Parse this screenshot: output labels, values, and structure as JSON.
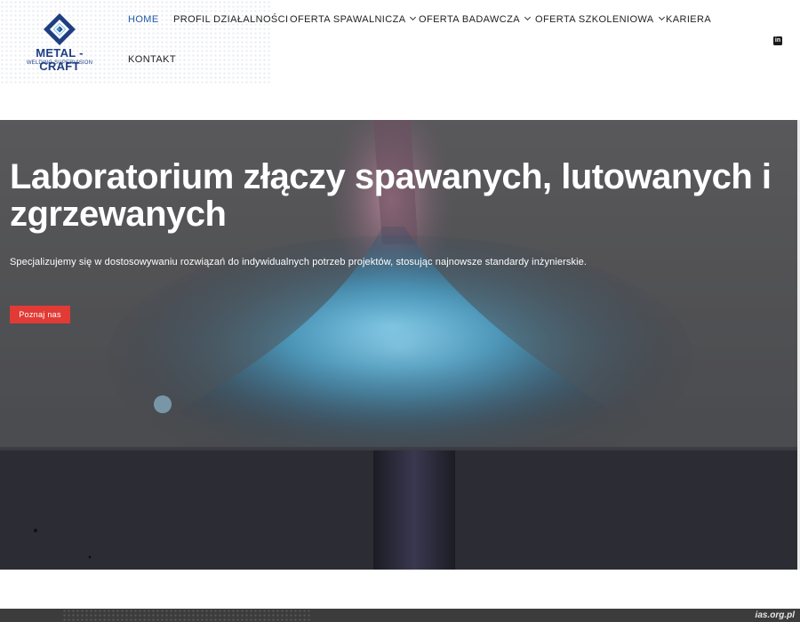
{
  "logo": {
    "name": "METAL - CRAFT",
    "tagline": "WELDING SUPERVISION",
    "color": "#1f3e82"
  },
  "nav": {
    "items": [
      {
        "label": "HOME",
        "active": true,
        "dropdown": false
      },
      {
        "label": "PROFIL DZIAŁALNOŚCI",
        "active": false,
        "dropdown": false
      },
      {
        "label": "OFERTA SPAWALNICZA",
        "active": false,
        "dropdown": true
      },
      {
        "label": "OFERTA BADAWCZA",
        "active": false,
        "dropdown": true
      },
      {
        "label": "OFERTA SZKOLENIOWA",
        "active": false,
        "dropdown": true
      },
      {
        "label": "KARIERA",
        "active": false,
        "dropdown": false
      },
      {
        "label": "KONTAKT",
        "active": false,
        "dropdown": false
      }
    ],
    "active_color": "#1f5aa6",
    "social_icon": "linkedin-icon"
  },
  "hero": {
    "title": "Laboratorium złączy spawanych, lutowanych i zgrzewanych",
    "subtitle": "Specjalizujemy się w dostosowywaniu rozwiązań do indywidualnych potrzeb projektów, stosując najnowsze standardy inżynierskie.",
    "button_label": "Poznaj nas",
    "button_color": "#e23a35"
  },
  "footer": {
    "watermark": "ias.org.pl"
  }
}
